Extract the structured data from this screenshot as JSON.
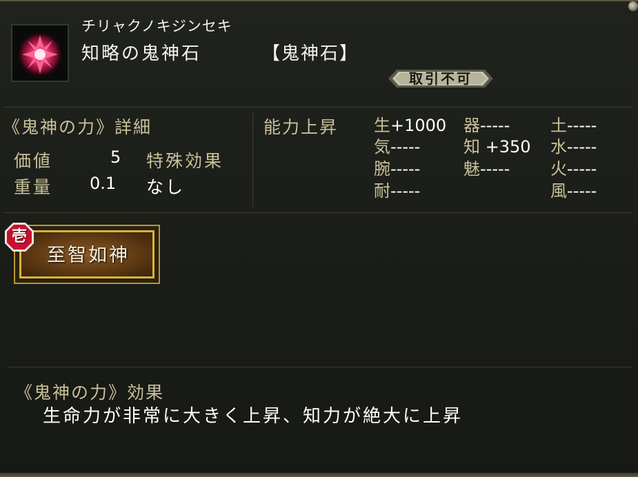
{
  "item": {
    "reading": "チリャクノキジンセキ",
    "name": "知略の鬼神石",
    "category": "【鬼神石】",
    "trade_status": "取引不可"
  },
  "details": {
    "title": "《鬼神の力》詳細",
    "value_label": "価値",
    "value": "5",
    "weight_label": "重量",
    "weight": "0.1",
    "special_label": "特殊効果",
    "special_value": "なし"
  },
  "stats": {
    "title": "能力上昇",
    "rows": [
      [
        {
          "key": "生",
          "value": "+1000"
        },
        {
          "key": "器",
          "value": "-----"
        },
        {
          "key": "土",
          "value": "-----"
        }
      ],
      [
        {
          "key": "気",
          "value": "-----"
        },
        {
          "key": "知",
          "value": " +350"
        },
        {
          "key": "水",
          "value": "-----"
        }
      ],
      [
        {
          "key": "腕",
          "value": "-----"
        },
        {
          "key": "魅",
          "value": "-----"
        },
        {
          "key": "火",
          "value": "-----"
        }
      ],
      [
        {
          "key": "耐",
          "value": "-----"
        },
        {
          "key": "",
          "value": ""
        },
        {
          "key": "風",
          "value": "-----"
        }
      ]
    ]
  },
  "skill": {
    "rank": "壱",
    "label": "至智如神"
  },
  "effect": {
    "title": "《鬼神の力》効果",
    "description": "生命力が非常に大きく上昇、知力が絶大に上昇"
  },
  "colors": {
    "label_gold": "#c9c09a",
    "text_white": "#ffffff",
    "skill_border": "#d6b43a",
    "rank_badge": "#c8102e"
  },
  "icons": {
    "item": "crimson-crystal-icon",
    "rank": "rank-badge-icon",
    "corner": "frame-corner-icon"
  }
}
